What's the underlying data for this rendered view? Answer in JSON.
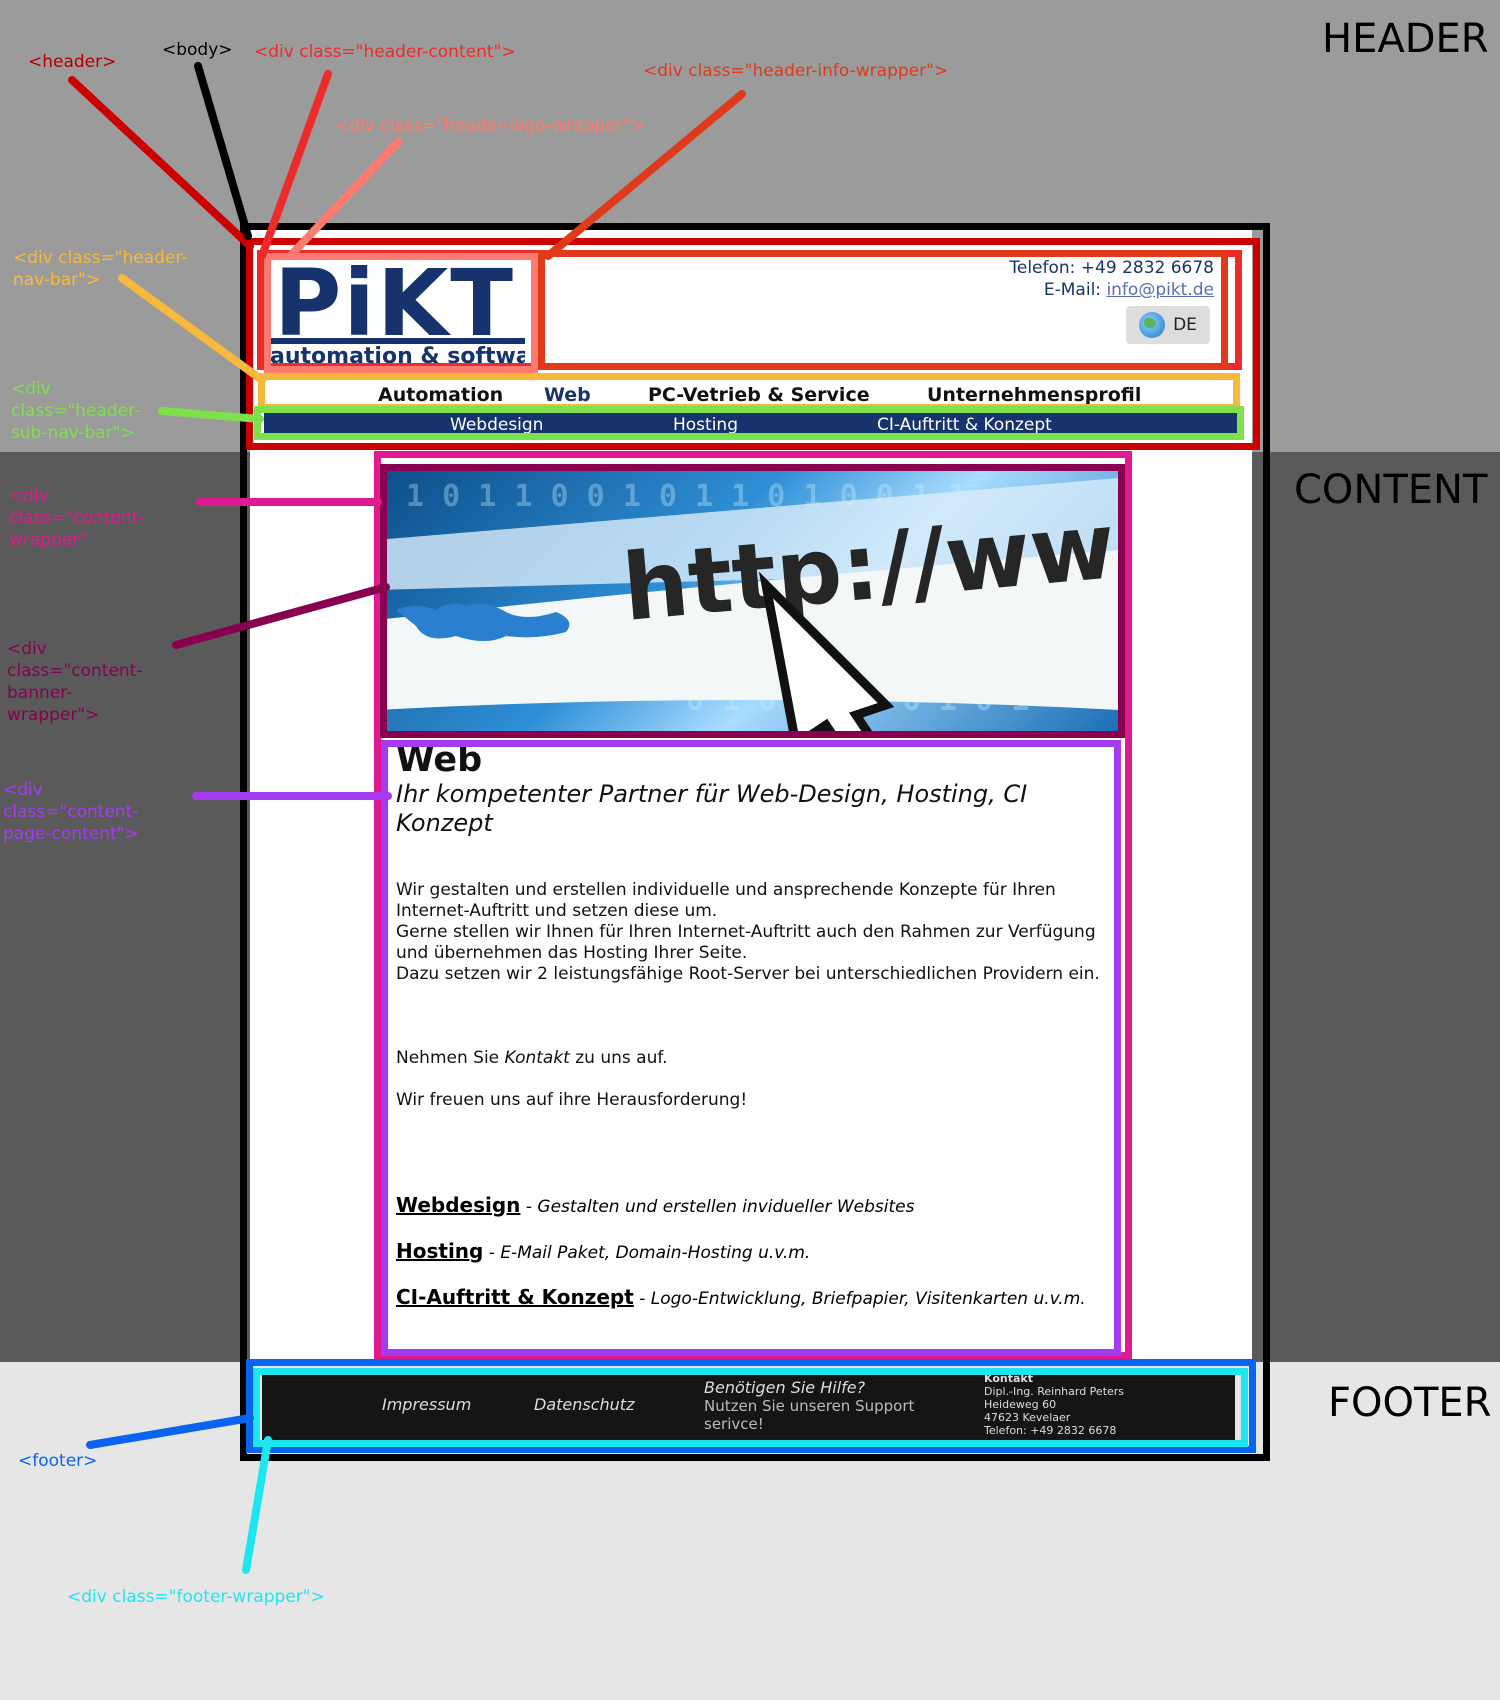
{
  "sections": {
    "header": "HEADER",
    "content": "CONTENT",
    "footer": "FOOTER"
  },
  "annotations": {
    "header": "<header>",
    "body": "<body>",
    "header_content": "<div class=\"header-content\">",
    "header_info_wrapper": "<div class=\"header-info-wrapper\">",
    "header_logo_wrapper": "<div class=\"header-logo-wrapper\">",
    "header_nav_bar": "<div class=\"header-nav-bar\">",
    "header_sub_nav_bar": "<div class=\"header-sub-nav-bar\">",
    "content_wrapper": "<div class=\"content-wrapper\"",
    "content_banner_wrapper": "<div class=\"content-banner-wrapper\">",
    "content_page_content": "<div class=\"content-page-content\">",
    "footer": "<footer>",
    "footer_wrapper": "<div class=\"footer-wrapper\">"
  },
  "colors": {
    "header": "#cc0000",
    "body": "#000000",
    "header_content": "#ee2b2b",
    "header_info_wrapper": "#e03a1a",
    "header_logo_wrapper": "#ff7a70",
    "header_nav_bar": "#f6b93b",
    "header_sub_nav_bar": "#7ee04a",
    "content_wrapper": "#e0198f",
    "content_banner_wrapper": "#8a0050",
    "content_page_content": "#a53bf0",
    "footer": "#0a64f0",
    "footer_wrapper": "#1ee6f0"
  },
  "logo": {
    "main": "PiKT",
    "sub": "automation & software"
  },
  "header_info": {
    "phone": "Telefon: +49 2832 6678",
    "email_label": "E-Mail:",
    "email": "info@pikt.de",
    "language": "DE",
    "language_icon": "globe-icon"
  },
  "nav": [
    "Automation",
    "Web",
    "PC-Vetrieb & Service",
    "Unternehmensprofil"
  ],
  "subnav": [
    "Webdesign",
    "Hosting",
    "CI-Auftritt & Konzept"
  ],
  "banner": {
    "text": "http://ww",
    "icon": "cursor-arrow-icon"
  },
  "page_content": {
    "title": "Web",
    "subtitle": "Ihr kompetenter Partner für Web-Design, Hosting, CI Konzept",
    "paragraph1": "Wir gestalten und erstellen individuelle und ansprechende Konzepte für Ihren Internet-Auftritt und setzen diese um.",
    "paragraph2": "Gerne stellen wir Ihnen für Ihren Internet-Auftritt auch den Rahmen zur Verfügung und übernehmen das Hosting Ihrer Seite.",
    "paragraph3": "Dazu setzen wir 2 leistungsfähige Root-Server bei unterschiedlichen Providern ein.",
    "contact_pre": "Nehmen Sie ",
    "contact_link": "Kontakt",
    "contact_post": " zu uns auf.",
    "closing": "Wir freuen uns auf ihre Herausforderung!",
    "services": [
      {
        "name": "Webdesign",
        "desc": "Gestalten und erstellen invidueller Websites"
      },
      {
        "name": "Hosting",
        "desc": "E-Mail Paket, Domain-Hosting u.v.m."
      },
      {
        "name": "CI-Auftritt & Konzept",
        "desc": "Logo-Entwicklung, Briefpapier, Visitenkarten u.v.m."
      }
    ]
  },
  "footer": {
    "impressum": "Impressum",
    "datenschutz": "Datenschutz",
    "help_title": "Benötigen Sie Hilfe?",
    "help_text": "Nutzen Sie unseren Support serivce!",
    "contact_title": "Kontakt",
    "contact_lines": [
      "Dipl.-Ing. Reinhard Peters",
      "Heideweg 60",
      "47623 Kevelaer",
      "Telefon: +49 2832 6678"
    ]
  }
}
